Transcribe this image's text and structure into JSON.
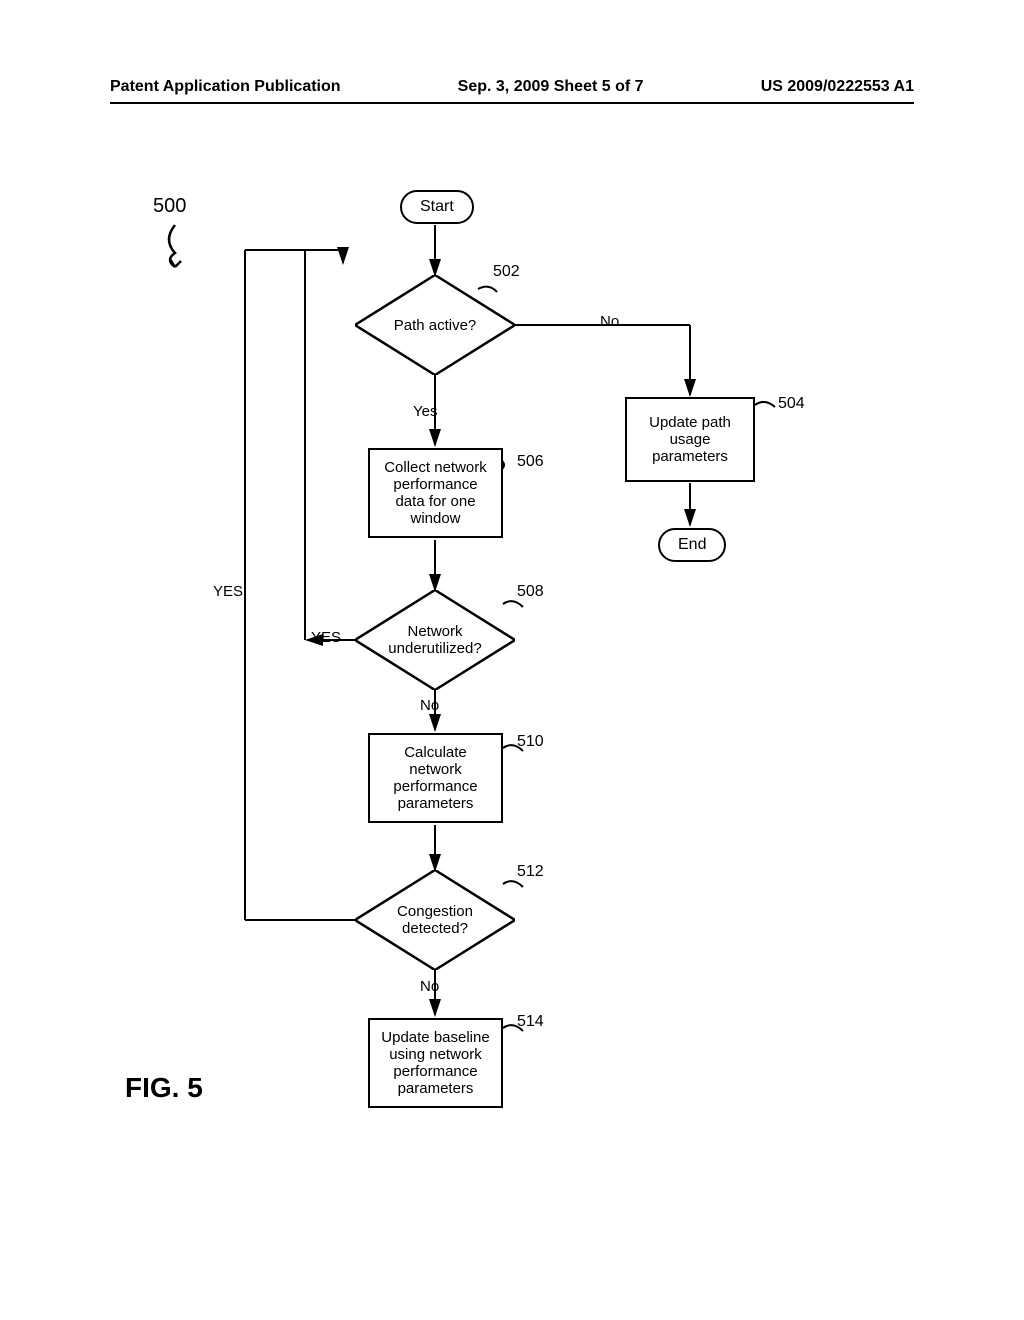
{
  "header": {
    "left": "Patent Application Publication",
    "center": "Sep. 3, 2009  Sheet 5 of 7",
    "right": "US 2009/0222553 A1"
  },
  "refs": {
    "fig_num": "500",
    "d502": "502",
    "d504": "504",
    "d506": "506",
    "d508": "508",
    "d510": "510",
    "d512": "512",
    "d514": "514"
  },
  "nodes": {
    "start": "Start",
    "end": "End",
    "path_active": "Path active?",
    "update_path": "Update path usage parameters",
    "collect": "Collect network performance data for one window",
    "underutilized": "Network underutilized?",
    "calculate": "Calculate network performance parameters",
    "congestion": "Congestion detected?",
    "update_baseline": "Update baseline using network performance parameters"
  },
  "edges": {
    "yes": "Yes",
    "no": "No",
    "yes_caps": "YES",
    "yes_arrow": "YES"
  },
  "figure": {
    "label": "FIG. 5"
  }
}
